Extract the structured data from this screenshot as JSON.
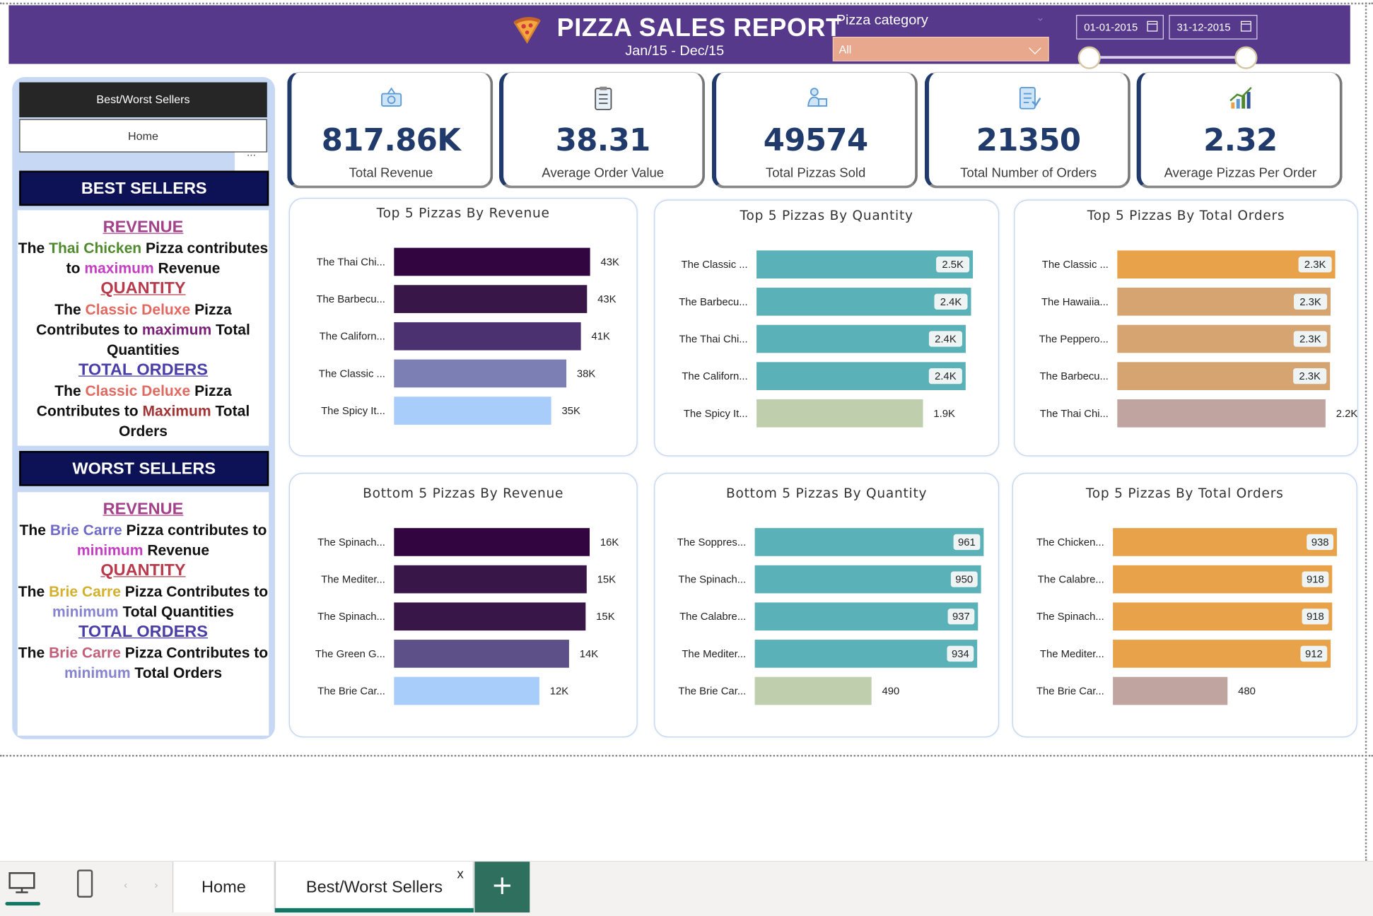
{
  "header": {
    "title": "PIZZA SALES REPORT",
    "subtitle": "Jan/15 - Dec/15",
    "category_label": "Pizza category",
    "category_selected": "All",
    "date_start": "01-01-2015",
    "date_end": "31-12-2015",
    "colors": {
      "header_bg": "#56398b",
      "kpi_text": "#1f3a6b"
    }
  },
  "nav": {
    "best_worst_button": "Best/Worst Sellers",
    "home_button": "Home",
    "more": "···"
  },
  "best": {
    "heading": "BEST SELLERS",
    "revenue_head": "REVENUE",
    "revenue": {
      "w1": "The",
      "pizza": "Thai Chicken",
      "w2": "Pizza contributes to",
      "hl": "maximum",
      "w3": "Revenue"
    },
    "quantity_head": "QUANTITY",
    "quantity": {
      "w1": "The",
      "pizza": "Classic Deluxe",
      "w2": "Pizza Contributes to",
      "hl": "maximum",
      "w3": "Total Quantities"
    },
    "orders_head": "TOTAL ORDERS",
    "orders": {
      "w1": "The",
      "pizza": "Classic Deluxe",
      "w2": "Pizza Contributes to",
      "hl": "Maximum",
      "w3": "Total Orders"
    }
  },
  "worst": {
    "heading": "WORST SELLERS",
    "revenue_head": "REVENUE",
    "revenue": {
      "w1": "The",
      "pizza": "Brie Carre",
      "w2": "Pizza contributes to",
      "hl": "minimum",
      "w3": "Revenue"
    },
    "quantity_head": "QUANTITY",
    "quantity": {
      "w1": "The",
      "pizza": "Brie Carre",
      "w2": "Pizza Contributes to",
      "hl": "minimum",
      "w3": "Total Quantities"
    },
    "orders_head": "TOTAL ORDERS",
    "orders": {
      "w1": "The",
      "pizza": "Brie Carre",
      "w2": "Pizza Contributes to",
      "hl": "minimum",
      "w3": "Total Orders"
    }
  },
  "kpis": [
    {
      "value": "817.86K",
      "label": "Total Revenue",
      "icon": "money-icon"
    },
    {
      "value": "38.31",
      "label": "Average Order Value",
      "icon": "clipboard-icon"
    },
    {
      "value": "49574",
      "label": "Total Pizzas Sold",
      "icon": "delivery-icon"
    },
    {
      "value": "21350",
      "label": "Total Number of Orders",
      "icon": "order-list-icon"
    },
    {
      "value": "2.32",
      "label": "Average Pizzas Per Order",
      "icon": "growth-chart-icon"
    }
  ],
  "chart_data": [
    {
      "type": "bar",
      "orientation": "horizontal",
      "title": "Top 5 Pizzas By Revenue",
      "categories": [
        "The Thai Chi...",
        "The Barbecu...",
        "The Californ...",
        "The Classic ...",
        "The Spicy It..."
      ],
      "values": [
        43434,
        42768,
        41410,
        38180,
        34831
      ],
      "labels": [
        "43K",
        "43K",
        "41K",
        "38K",
        "35K"
      ],
      "xlim": [
        0,
        52000
      ],
      "label_position": "outside",
      "colors": [
        "#330540",
        "#391648",
        "#4b3170",
        "#7b7fb4",
        "#a8cdfb"
      ]
    },
    {
      "type": "bar",
      "orientation": "horizontal",
      "title": "Top 5 Pizzas By Quantity",
      "categories": [
        "The Classic ...",
        "The Barbecu...",
        "The Thai Chi...",
        "The Californ...",
        "The Spicy It..."
      ],
      "values": [
        2453,
        2432,
        2371,
        2370,
        1887
      ],
      "labels": [
        "2.5K",
        "2.4K",
        "2.4K",
        "2.4K",
        "1.9K"
      ],
      "xlim": [
        0,
        2700
      ],
      "label_position": "inside",
      "colors": [
        "#5ab1b7",
        "#5ab1b7",
        "#5ab1b7",
        "#5ab1b7",
        "#bfcfad"
      ]
    },
    {
      "type": "bar",
      "orientation": "horizontal",
      "title": "Top 5 Pizzas By Total Orders",
      "categories": [
        "The Classic ...",
        "The Hawaiia...",
        "The Peppero...",
        "The Barbecu...",
        "The Thai Chi..."
      ],
      "values": [
        2329,
        2280,
        2278,
        2273,
        2225
      ],
      "labels": [
        "2.3K",
        "2.3K",
        "2.3K",
        "2.3K",
        "2.2K"
      ],
      "xlim": [
        0,
        2480
      ],
      "label_position": "inside",
      "colors": [
        "#e8a34a",
        "#d6a470",
        "#d6a470",
        "#d6a470",
        "#c0a4a0"
      ]
    },
    {
      "type": "bar",
      "orientation": "horizontal",
      "title": "Bottom 5 Pizzas By Revenue",
      "categories": [
        "The Spinach...",
        "The Mediter...",
        "The Spinach...",
        "The Green G...",
        "The Brie Car..."
      ],
      "values": [
        15596,
        15360,
        15277,
        13956,
        11588
      ],
      "labels": [
        "16K",
        "15K",
        "15K",
        "14K",
        "12K"
      ],
      "xlim": [
        0,
        18500
      ],
      "label_position": "outside",
      "colors": [
        "#330540",
        "#391648",
        "#391648",
        "#5d5088",
        "#a8cdfb"
      ]
    },
    {
      "type": "bar",
      "orientation": "horizontal",
      "title": "Bottom 5 Pizzas By Quantity",
      "categories": [
        "The Soppres...",
        "The Spinach...",
        "The Calabre...",
        "The Mediter...",
        "The Brie Car..."
      ],
      "values": [
        961,
        950,
        937,
        934,
        490
      ],
      "labels": [
        "961",
        "950",
        "937",
        "934",
        "490"
      ],
      "xlim": [
        0,
        1000
      ],
      "label_position": "inside",
      "colors": [
        "#5ab1b7",
        "#5ab1b7",
        "#5ab1b7",
        "#5ab1b7",
        "#bfcfad"
      ]
    },
    {
      "type": "bar",
      "orientation": "horizontal",
      "title": "Top 5 Pizzas By Total Orders",
      "categories": [
        "The Chicken...",
        "The Calabre...",
        "The Spinach...",
        "The Mediter...",
        "The Brie Car..."
      ],
      "values": [
        938,
        918,
        918,
        912,
        480
      ],
      "labels": [
        "938",
        "918",
        "918",
        "912",
        "480"
      ],
      "xlim": [
        0,
        990
      ],
      "label_position": "inside",
      "colors": [
        "#e8a34a",
        "#e8a34a",
        "#e8a34a",
        "#e8a34a",
        "#c0a4a0"
      ]
    }
  ],
  "tabs": {
    "home": "Home",
    "best_worst": "Best/Worst Sellers",
    "close": "x",
    "add": "+",
    "prev": "‹",
    "next": "›"
  }
}
